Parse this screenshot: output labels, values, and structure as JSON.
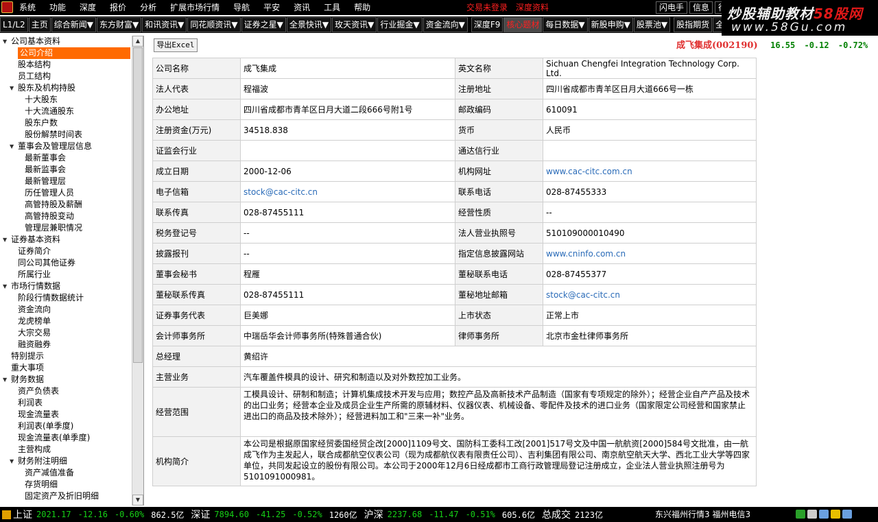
{
  "menubar": {
    "items": [
      "系统",
      "功能",
      "深度",
      "报价",
      "分析",
      "扩展市场行情",
      "导航",
      "平安",
      "资讯",
      "工具",
      "帮助"
    ],
    "center": [
      "交易未登录",
      "深度资料"
    ],
    "right": [
      "闪电手",
      "信息",
      "行"
    ]
  },
  "watermark": {
    "line1_a": "炒股辅助教材",
    "line1_b": "58股网",
    "line2": "www.58Gu.com"
  },
  "tabs": [
    "L1/L2",
    "主页",
    "综合新闻▼",
    "东方财富▼",
    "和讯资讯▼",
    "同花顺资讯▼",
    "证券之星▼",
    "全景快讯▼",
    "玫天资讯▼",
    "行业掘金▼",
    "资金流向▼",
    "深度F9",
    "核心题材",
    "每日数据▼",
    "新股申购▼",
    "股票池▼",
    "股指期货",
    "全球指"
  ],
  "active_tab_index": 12,
  "sidebar": {
    "items": [
      {
        "label": "公司基本资料",
        "level": 0,
        "toggle": "▼"
      },
      {
        "label": "公司介绍",
        "level": 1,
        "selected": true
      },
      {
        "label": "股本结构",
        "level": 1
      },
      {
        "label": "员工结构",
        "level": 1
      },
      {
        "label": "股东及机构持股",
        "level": 1,
        "toggle": "▼"
      },
      {
        "label": "十大股东",
        "level": 2
      },
      {
        "label": "十大流通股东",
        "level": 2
      },
      {
        "label": "股东户数",
        "level": 2
      },
      {
        "label": "股份解禁时间表",
        "level": 2
      },
      {
        "label": "董事会及管理层信息",
        "level": 1,
        "toggle": "▼"
      },
      {
        "label": "最新董事会",
        "level": 2
      },
      {
        "label": "最新监事会",
        "level": 2
      },
      {
        "label": "最新管理层",
        "level": 2
      },
      {
        "label": "历任管理人员",
        "level": 2
      },
      {
        "label": "高管持股及薪酬",
        "level": 2
      },
      {
        "label": "高管持股变动",
        "level": 2
      },
      {
        "label": "管理层兼职情况",
        "level": 2
      },
      {
        "label": "证券基本资料",
        "level": 0,
        "toggle": "▼"
      },
      {
        "label": "证券简介",
        "level": 1
      },
      {
        "label": "同公司其他证券",
        "level": 1
      },
      {
        "label": "所属行业",
        "level": 1
      },
      {
        "label": "市场行情数据",
        "level": 0,
        "toggle": "▼"
      },
      {
        "label": "阶段行情数据统计",
        "level": 1
      },
      {
        "label": "资金流向",
        "level": 1
      },
      {
        "label": "龙虎榜单",
        "level": 1
      },
      {
        "label": "大宗交易",
        "level": 1
      },
      {
        "label": "融资融券",
        "level": 1
      },
      {
        "label": "特别提示",
        "level": 0
      },
      {
        "label": "重大事项",
        "level": 0
      },
      {
        "label": "财务数据",
        "level": 0,
        "toggle": "▼"
      },
      {
        "label": "资产负债表",
        "level": 1
      },
      {
        "label": "利润表",
        "level": 1
      },
      {
        "label": "现金流量表",
        "level": 1
      },
      {
        "label": "利润表(单季度)",
        "level": 1
      },
      {
        "label": "现金流量表(单季度)",
        "level": 1
      },
      {
        "label": "主营构成",
        "level": 1
      },
      {
        "label": "财务附注明细",
        "level": 1,
        "toggle": "▼"
      },
      {
        "label": "资产减值准备",
        "level": 2
      },
      {
        "label": "存货明细",
        "level": 2
      },
      {
        "label": "固定资产及折旧明细",
        "level": 2
      }
    ]
  },
  "main": {
    "export_label": "导出Excel",
    "stock": {
      "name": "成飞集成",
      "code": "(002190)",
      "price": "16.55",
      "change": "-0.12",
      "pct": "-0.72%"
    },
    "rows": [
      {
        "k1": "公司名称",
        "v1": "成飞集成",
        "k2": "英文名称",
        "v2": "Sichuan Chengfei Integration Technology Corp. Ltd."
      },
      {
        "k1": "法人代表",
        "v1": "程福波",
        "k2": "注册地址",
        "v2": "四川省成都市青羊区日月大道666号一栋"
      },
      {
        "k1": "办公地址",
        "v1": "四川省成都市青羊区日月大道二段666号附1号",
        "k2": "邮政编码",
        "v2": "610091"
      },
      {
        "k1": "注册资金(万元)",
        "v1": "34518.838",
        "k2": "货币",
        "v2": "人民币"
      },
      {
        "k1": "证监会行业",
        "v1": "",
        "k2": "通达信行业",
        "v2": ""
      },
      {
        "k1": "成立日期",
        "v1": "2000-12-06",
        "k2": "机构网址",
        "v2": "www.cac-citc.com.cn",
        "v2link": true
      },
      {
        "k1": "电子信箱",
        "v1": "stock@cac-citc.cn",
        "v1link": true,
        "k2": "联系电话",
        "v2": "028-87455333"
      },
      {
        "k1": "联系传真",
        "v1": "028-87455111",
        "k2": "经营性质",
        "v2": "--"
      },
      {
        "k1": "税务登记号",
        "v1": "--",
        "k2": "法人营业执照号",
        "v2": "510109000010490"
      },
      {
        "k1": "披露报刊",
        "v1": "--",
        "k2": "指定信息披露网站",
        "v2": "www.cninfo.com.cn",
        "v2link": true
      },
      {
        "k1": "董事会秘书",
        "v1": "程雁",
        "k2": "董秘联系电话",
        "v2": "028-87455377"
      },
      {
        "k1": "董秘联系传真",
        "v1": "028-87455111",
        "k2": "董秘地址邮箱",
        "v2": "stock@cac-citc.cn",
        "v2link": true
      },
      {
        "k1": "证券事务代表",
        "v1": "巨美娜",
        "k2": "上市状态",
        "v2": "正常上市"
      },
      {
        "k1": "会计师事务所",
        "v1": "中瑞岳华会计师事务所(特殊普通合伙)",
        "k2": "律师事务所",
        "v2": "北京市金杜律师事务所"
      }
    ],
    "general_manager": {
      "k": "总经理",
      "v": "黄绍许"
    },
    "main_business": {
      "k": "主营业务",
      "v": "汽车覆盖件模具的设计、研究和制造以及对外数控加工业务。"
    },
    "business_scope": {
      "k": "经营范围",
      "v": "工模具设计、研制和制造；计算机集成技术开发与应用；数控产品及高新技术产品制造（国家有专项规定的除外）；经营企业自产产品及技术的出口业务；经营本企业及成员企业生产所需的原辅材料、仪器仪表、机械设备、零配件及技术的进口业务（国家限定公司经营和国家禁止进出口的商品及技术除外）；经营进料加工和\"三来一补\"业务。"
    },
    "profile": {
      "k": "机构简介",
      "v": "本公司是根据原国家经贸委国经贸企改[2000]1109号文、国防科工委科工改[2001]517号文及中国一航航资[2000]584号文批准，由一航成飞作为主发起人，联合成都航空仪表公司（现为成都航仪表有限责任公司）、吉利集团有限公司、南京航空航天大学、西北工业大学等四家单位，共同发起设立的股份有限公司。本公司于2000年12月6日经成都市工商行政管理局登记注册成立，企业法人营业执照注册号为5101091000981。"
    }
  },
  "statusbar": {
    "sh": {
      "name": "上证",
      "index": "2021.17",
      "change": "-12.16",
      "pct": "-0.60%",
      "amount": "862.5亿"
    },
    "sz": {
      "name": "深证",
      "index": "7894.60",
      "change": "-41.25",
      "pct": "-0.52%",
      "amount": "1260亿"
    },
    "hs": {
      "name": "沪深",
      "index": "2237.68",
      "change": "-11.47",
      "pct": "-0.51%",
      "amount": "605.6亿"
    },
    "total": {
      "name": "总成交",
      "amount": "2123亿"
    },
    "tail": "东兴福州行情3  福州电信3"
  },
  "colors": {
    "accent": "#ff6a00",
    "up_red": "#e03030",
    "down_green": "#16d016",
    "link": "#2a6bb8"
  }
}
